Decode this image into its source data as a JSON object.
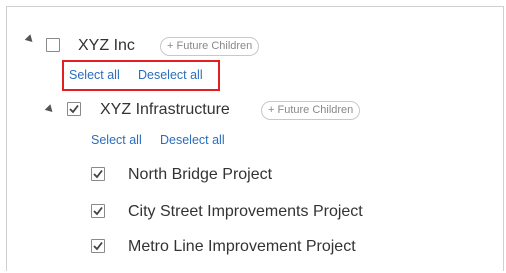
{
  "tree": {
    "root": {
      "label": "XYZ Inc",
      "future_children": "+ Future Children",
      "select_all": "Select all",
      "deselect_all": "Deselect all"
    },
    "child": {
      "label": "XYZ Infrastructure",
      "future_children": "+ Future Children",
      "select_all": "Select all",
      "deselect_all": "Deselect all",
      "projects": [
        {
          "label": "North Bridge Project",
          "checked": true
        },
        {
          "label": "City Street Improvements Project",
          "checked": true
        },
        {
          "label": "Metro Line Improvement Project",
          "checked": true
        }
      ]
    }
  },
  "colors": {
    "link": "#2a6ebb",
    "highlight": "#e02020"
  }
}
